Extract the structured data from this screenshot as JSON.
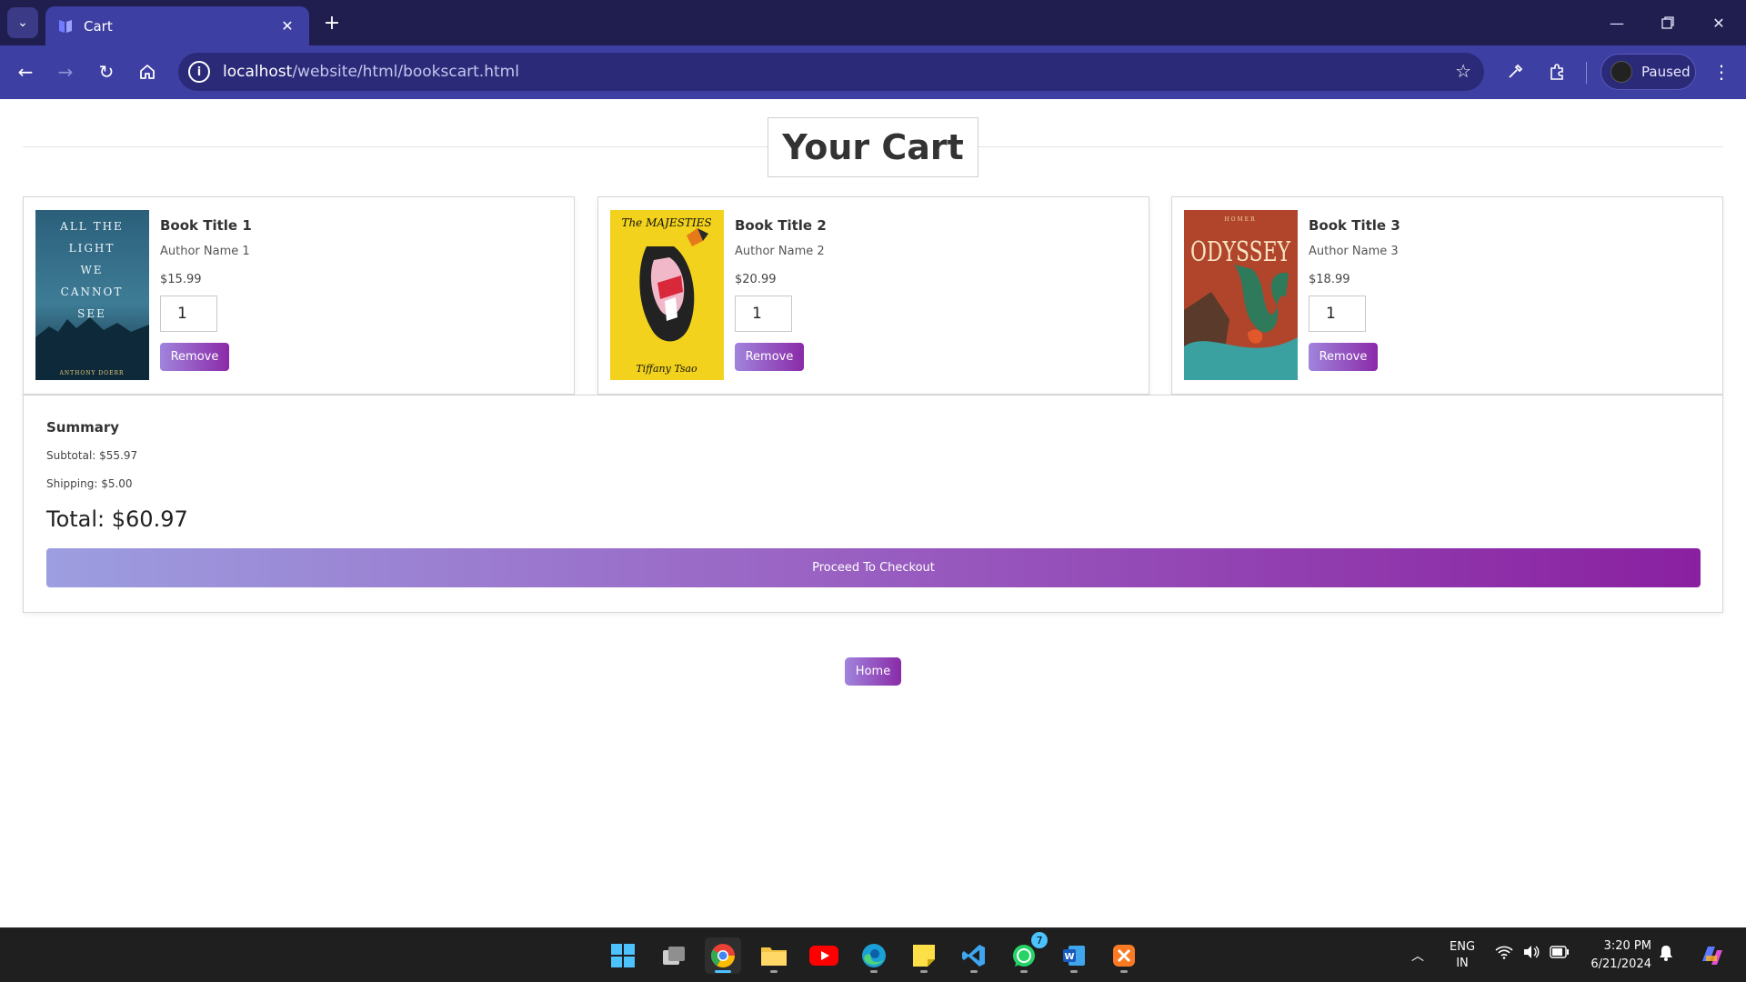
{
  "browser": {
    "tab_title": "Cart",
    "url_host": "localhost",
    "url_path": "/website/html/bookscart.html",
    "profile_label": "Paused"
  },
  "page": {
    "title": "Your Cart",
    "books": [
      {
        "title": "Book Title 1",
        "author": "Author Name 1",
        "price": "$15.99",
        "quantity": "1",
        "remove_label": "Remove",
        "cover_lines": [
          "ALL THE",
          "LIGHT",
          "WE",
          "CANNOT",
          "SEE"
        ],
        "cover_author": "ANTHONY DOERR"
      },
      {
        "title": "Book Title 2",
        "author": "Author Name 2",
        "price": "$20.99",
        "quantity": "1",
        "remove_label": "Remove",
        "cover_lines": [
          "The MAJESTIES"
        ],
        "cover_author": "Tiffany Tsao"
      },
      {
        "title": "Book Title 3",
        "author": "Author Name 3",
        "price": "$18.99",
        "quantity": "1",
        "remove_label": "Remove",
        "cover_lines": [
          "ODYSSEY"
        ],
        "cover_author": "HOMER"
      }
    ],
    "summary": {
      "heading": "Summary",
      "subtotal": "Subtotal: $55.97",
      "shipping": "Shipping: $5.00",
      "total": "Total: $60.97",
      "checkout_label": "Proceed To Checkout"
    },
    "home_label": "Home"
  },
  "taskbar": {
    "lang_line1": "ENG",
    "lang_line2": "IN",
    "time": "3:20 PM",
    "date": "6/21/2024",
    "whatsapp_badge": "7",
    "apps": [
      "start-icon",
      "task-view-icon",
      "chrome-icon",
      "file-explorer-icon",
      "youtube-icon",
      "edge-icon",
      "sticky-notes-icon",
      "vscode-icon",
      "whatsapp-icon",
      "word-icon",
      "xampp-icon"
    ]
  },
  "colors": {
    "titlebar": "#1f1e4e",
    "toolbar": "#3e3fa3",
    "button_gradient_start": "#a084dc",
    "button_gradient_end": "#8a2aa8"
  }
}
